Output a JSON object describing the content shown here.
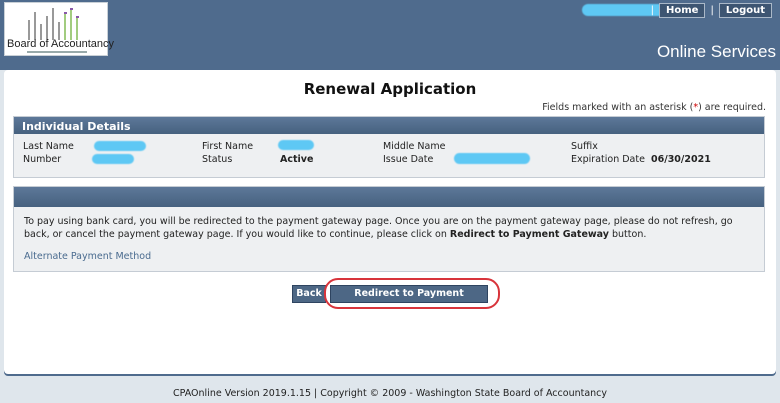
{
  "header": {
    "logo_text": "Board of Accountancy",
    "top_links": [
      "Home",
      "Logout"
    ],
    "separator": "|",
    "site_name": "Online Services"
  },
  "page": {
    "title": "Renewal Application",
    "required_note_pre": "Fields marked with an asterisk (",
    "required_note_ast": "*",
    "required_note_post": ") are required."
  },
  "details": {
    "heading": "Individual Details",
    "labels": {
      "last_name": "Last Name",
      "number": "Number",
      "first_name": "First Name",
      "status": "Status",
      "middle_name": "Middle Name",
      "issue_date": "Issue Date",
      "suffix": "Suffix",
      "expiration_date": "Expiration Date"
    },
    "values": {
      "status": "Active",
      "expiration_date": "06/30/2021"
    }
  },
  "payment": {
    "text_pre": "To pay using bank card, you will be redirected to the payment gateway page. Once you are on the payment gateway page, please do not refresh, go back, or cancel the payment gateway page. If you would like to continue, please click on ",
    "text_bold": "Redirect to Payment Gateway",
    "text_post": " button.",
    "alt_link": "Alternate Payment Method"
  },
  "actions": {
    "back": "Back",
    "redirect": "Redirect to Payment Gateway"
  },
  "footer": {
    "text": "CPAOnline Version 2019.1.15 | Copyright © 2009 - Washington State Board of Accountancy"
  },
  "colors": {
    "header_blue": "#4f6b8d",
    "redaction": "#5ec8f4",
    "annotation_red": "#d8343b"
  }
}
